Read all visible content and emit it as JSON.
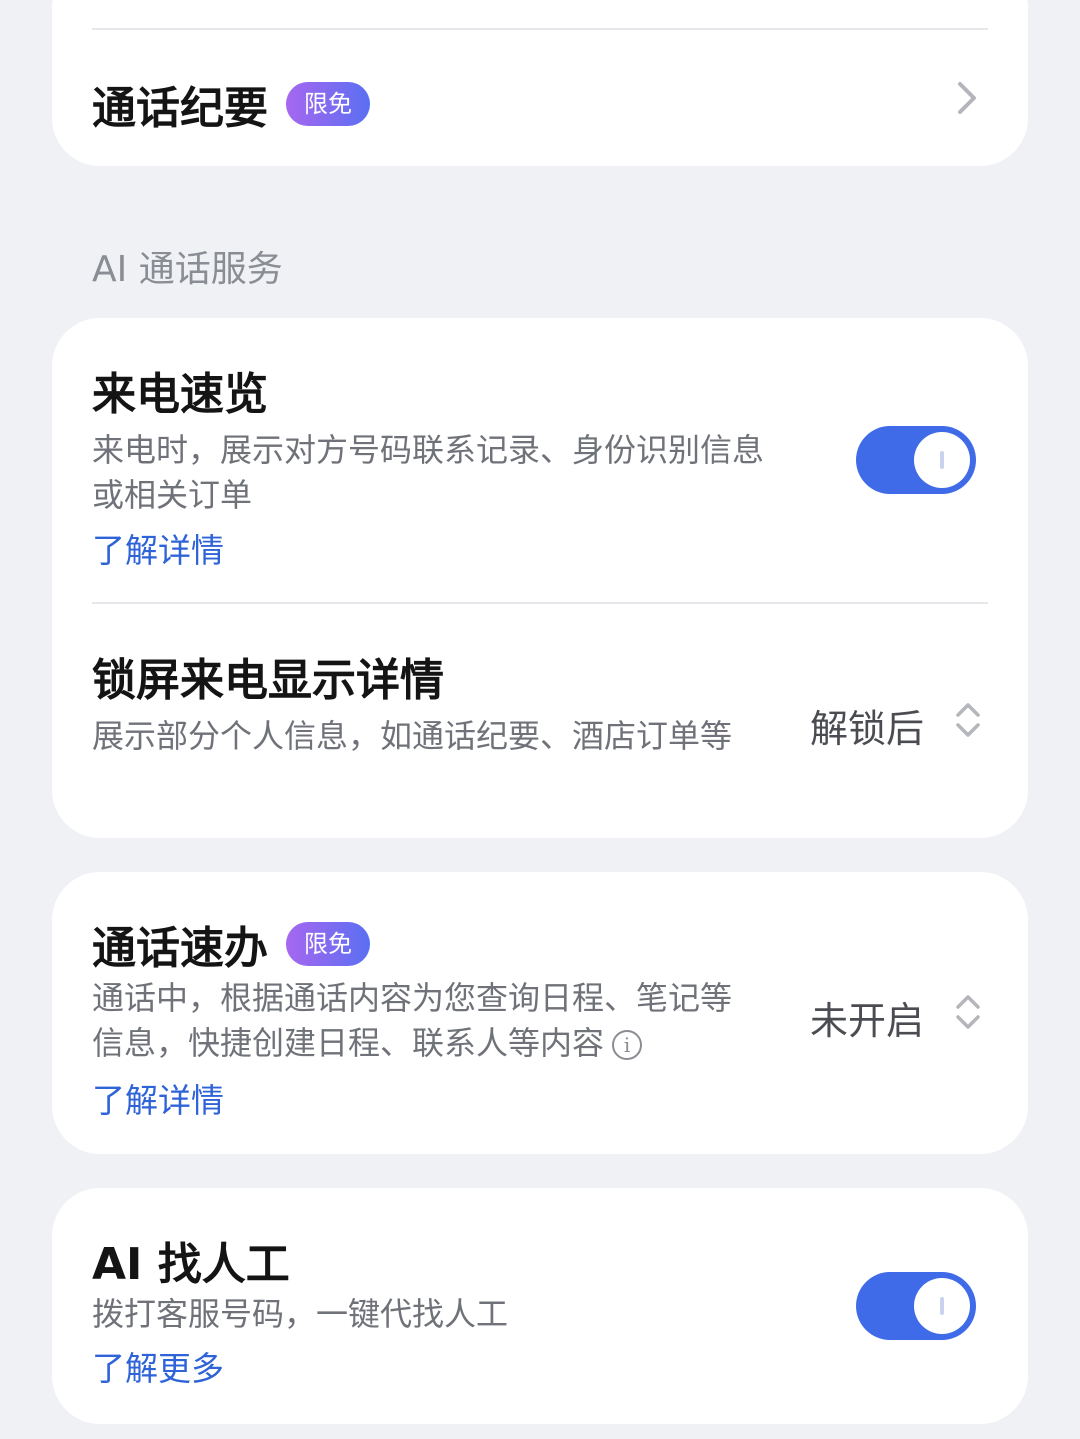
{
  "call_summary": {
    "title": "通话纪要",
    "badge": "限免",
    "icon": "chevron-right-icon"
  },
  "section": {
    "label": "AI 通话服务"
  },
  "incoming_preview": {
    "title": "来电速览",
    "description": "来电时，展示对方号码联系记录、身份识别信息或相关订单",
    "link": "了解详情",
    "toggle_on": true
  },
  "lockscreen_details": {
    "title": "锁屏来电显示详情",
    "description": "展示部分个人信息，如通话纪要、酒店订单等",
    "value": "解锁后",
    "icon": "up-down-chevron-icon"
  },
  "call_quick_action": {
    "title": "通话速办",
    "badge": "限免",
    "description": "通话中，根据通话内容为您查询日程、笔记等信息，快捷创建日程、联系人等内容",
    "info_glyph": "i",
    "link": "了解详情",
    "value": "未开启",
    "icon": "up-down-chevron-icon"
  },
  "ai_human": {
    "title": "AI 找人工",
    "description": "拨打客服号码，一键代找人工",
    "link": "了解更多",
    "toggle_on": true
  },
  "colors": {
    "background": "#eff1f5",
    "card": "#ffffff",
    "toggle_on": "#3f6be8",
    "link": "#2f63d8",
    "badge_gradient_start": "#a667f0",
    "badge_gradient_end": "#5b6ff2"
  }
}
